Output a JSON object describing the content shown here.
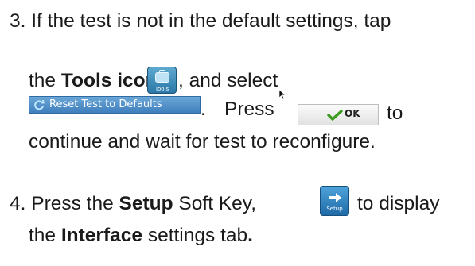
{
  "step3": {
    "line1": "3. If the test is not in the default settings, tap",
    "the_prefix": "the ",
    "tools_bold": "Tools icon",
    "tools_icon_label": "Tools",
    "and_select": ", and select",
    "reset_button_label": "Reset Test to Defaults",
    "period": ".",
    "press": "Press",
    "ok_label": "OK",
    "to": "to",
    "line4": "continue and wait for test to reconfigure."
  },
  "step4": {
    "prefix": "4. Press the ",
    "setup_bold": "Setup",
    "soft_key": " Soft Key,",
    "setup_icon_label": "Setup",
    "to_display": "to display",
    "the_prefix": "the ",
    "interface_bold": "Interface",
    "settings_tab": " settings tab",
    "period": "."
  },
  "colors": {
    "icon_blue": "#2b78a8",
    "button_blue": "#3f7fbd",
    "check_green": "#3c9a1e"
  },
  "icons": [
    "tools-icon",
    "refresh-icon",
    "check-icon",
    "cursor-icon",
    "arrow-right-icon"
  ]
}
